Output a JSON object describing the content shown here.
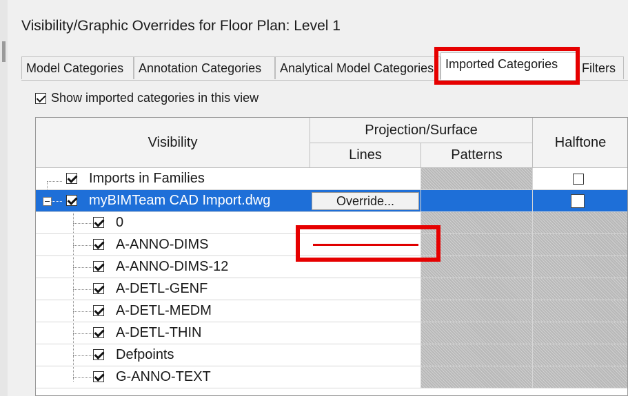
{
  "window": {
    "title": "Visibility/Graphic Overrides for Floor Plan: Level 1"
  },
  "tabs": [
    {
      "label": "Model Categories",
      "active": false
    },
    {
      "label": "Annotation Categories",
      "active": false
    },
    {
      "label": "Analytical Model Categories",
      "active": false
    },
    {
      "label": "Imported Categories",
      "active": true
    },
    {
      "label": "Filters",
      "active": false
    }
  ],
  "show_imported": {
    "label": "Show imported categories in this view",
    "checked": true
  },
  "table": {
    "headers": {
      "visibility": "Visibility",
      "projection_surface": "Projection/Surface",
      "lines": "Lines",
      "patterns": "Patterns",
      "halftone": "Halftone"
    },
    "override_button": "Override...",
    "rows": [
      {
        "name": "Imports in Families",
        "checked": true,
        "halftone": false,
        "selected": false
      },
      {
        "name": "myBIMTeam CAD Import.dwg",
        "checked": true,
        "halftone": false,
        "selected": true,
        "expanded": true
      },
      {
        "name": "0",
        "checked": true
      },
      {
        "name": "A-ANNO-DIMS",
        "checked": true,
        "line_override_color": "#e00000"
      },
      {
        "name": "A-ANNO-DIMS-12",
        "checked": true
      },
      {
        "name": "A-DETL-GENF",
        "checked": true
      },
      {
        "name": "A-DETL-MEDM",
        "checked": true
      },
      {
        "name": "A-DETL-THIN",
        "checked": true
      },
      {
        "name": "Defpoints",
        "checked": true
      },
      {
        "name": "G-ANNO-TEXT",
        "checked": true
      }
    ]
  },
  "colors": {
    "selection": "#1e6fd8",
    "annotation_highlight": "#e60000"
  }
}
